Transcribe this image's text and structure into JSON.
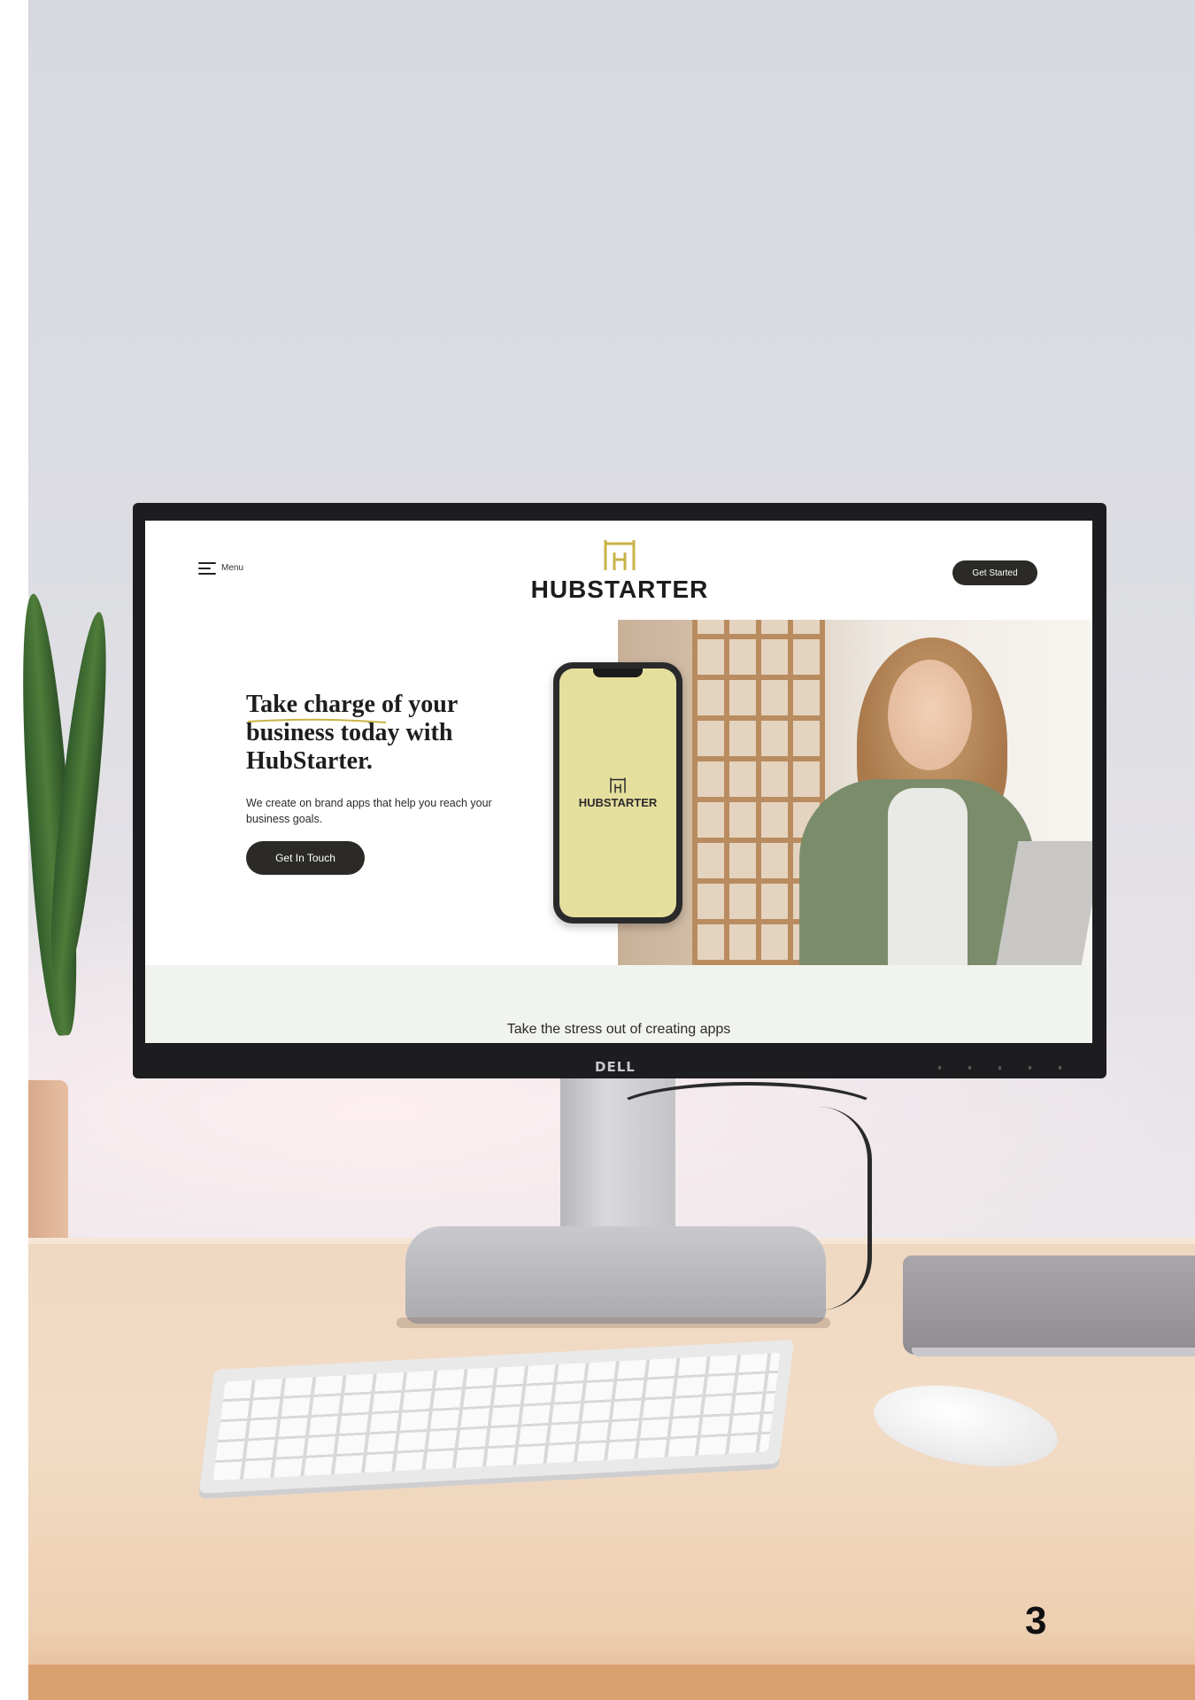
{
  "site": {
    "menu_label": "Menu",
    "brand_name": "HUBSTARTER",
    "cta_header": "Get Started",
    "hero_title": "Take charge of your business today with HubStarter.",
    "hero_subtitle": "We create on brand apps that help you reach your business goals.",
    "hero_button": "Get In Touch",
    "phone_brand": "HUBSTARTER",
    "band_text": "Take the stress out of creating apps"
  },
  "monitor": {
    "brand": "DELL"
  },
  "page_number": "3",
  "colors": {
    "brand_gold": "#c8b347",
    "button_dark": "#2b2a27",
    "phone_screen": "#e5df9e",
    "band_bg": "#f1f3ee"
  },
  "icons": [
    "hamburger-menu-icon",
    "hubstarter-logo-icon"
  ]
}
